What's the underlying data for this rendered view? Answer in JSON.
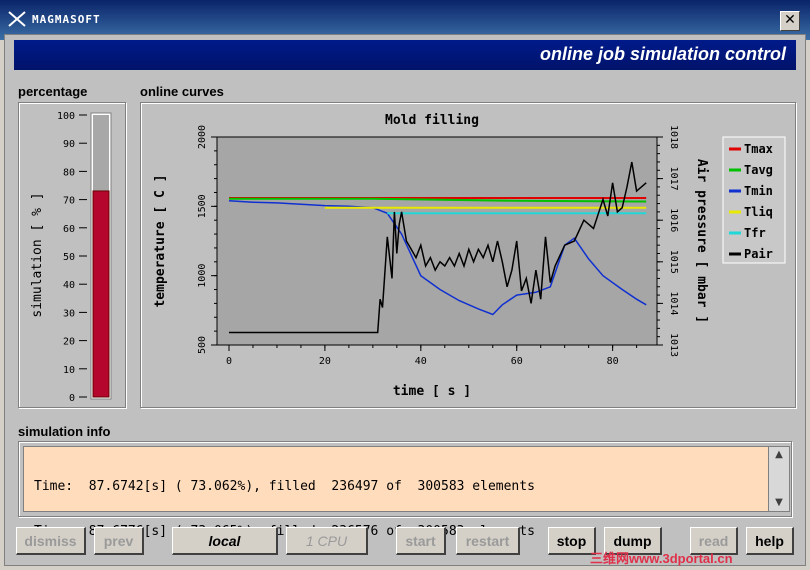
{
  "window": {
    "title": "MAGMASOFT",
    "close_label": "✕"
  },
  "header": {
    "banner_title": "online job simulation control"
  },
  "percentage": {
    "label": "percentage",
    "axis_label": "simulation [ % ]",
    "ticks": [
      "100",
      "90",
      "80",
      "70",
      "60",
      "50",
      "40",
      "30",
      "20",
      "10",
      "0"
    ],
    "value": 73.06,
    "fill_color": "#b5062d"
  },
  "curves": {
    "label": "online curves",
    "chart_data": {
      "type": "line",
      "title": "Mold filling",
      "xlabel": "time [ s ]",
      "ylabel": "temperature [ C ]",
      "y2label": "Air pressure [ mbar ]",
      "xlim": [
        0,
        88
      ],
      "ylim": [
        500,
        2000
      ],
      "y2lim": [
        1013,
        1018
      ],
      "x_ticks": [
        "0",
        "20",
        "40",
        "60",
        "80"
      ],
      "y_ticks": [
        "500",
        "1000",
        "1500",
        "2000"
      ],
      "y2_ticks": [
        "1013",
        "1014",
        "1015",
        "1016",
        "1017",
        "1018"
      ],
      "legend_position": "right",
      "series": [
        {
          "name": "Tmax",
          "color": "#e00000",
          "axis": "left",
          "x": [
            0,
            87
          ],
          "y": [
            1560,
            1560
          ]
        },
        {
          "name": "Tavg",
          "color": "#00c000",
          "axis": "left",
          "x": [
            0,
            30,
            60,
            87
          ],
          "y": [
            1555,
            1555,
            1540,
            1535
          ]
        },
        {
          "name": "Tmin",
          "color": "#1030d0",
          "axis": "left",
          "x": [
            0,
            5,
            10,
            15,
            20,
            25,
            30,
            33,
            36,
            38,
            40,
            44,
            48,
            52,
            55,
            57,
            60,
            64,
            67,
            70,
            72,
            75,
            78,
            82,
            85,
            87
          ],
          "y": [
            1540,
            1530,
            1525,
            1515,
            1505,
            1500,
            1490,
            1450,
            1300,
            1150,
            1000,
            900,
            820,
            760,
            720,
            790,
            860,
            880,
            920,
            1220,
            1270,
            1120,
            1000,
            900,
            830,
            790
          ]
        },
        {
          "name": "Tliq",
          "color": "#e8e800",
          "axis": "left",
          "x": [
            20,
            87
          ],
          "y": [
            1490,
            1490
          ]
        },
        {
          "name": "Tfr",
          "color": "#20d8d8",
          "axis": "left",
          "x": [
            33,
            87
          ],
          "y": [
            1450,
            1450
          ]
        },
        {
          "name": "Pair",
          "color": "#000000",
          "axis": "right",
          "x": [
            0,
            31,
            31.5,
            32,
            33,
            34,
            34.5,
            35,
            35.5,
            36,
            37,
            38,
            39,
            40,
            41,
            42,
            43,
            44,
            45,
            46,
            47,
            48,
            49,
            50,
            51,
            52,
            53,
            54,
            55,
            56,
            57,
            58,
            59,
            60,
            61,
            62,
            63,
            64,
            65,
            66,
            67,
            68,
            70,
            72,
            74,
            76,
            78,
            79,
            80,
            81,
            82,
            83,
            84,
            85,
            86,
            87
          ],
          "y": [
            1013.3,
            1013.3,
            1014.1,
            1013.9,
            1015.6,
            1014.6,
            1016.2,
            1015.2,
            1015.9,
            1016.2,
            1015.5,
            1015.3,
            1015.1,
            1015.4,
            1014.9,
            1015.1,
            1014.8,
            1015.0,
            1014.9,
            1015.1,
            1014.9,
            1015.2,
            1014.9,
            1015.3,
            1015.0,
            1015.3,
            1015.1,
            1015.4,
            1015.0,
            1015.5,
            1015.0,
            1014.4,
            1014.8,
            1015.5,
            1014.3,
            1014.6,
            1014.0,
            1014.8,
            1014.1,
            1015.6,
            1014.5,
            1014.9,
            1015.4,
            1015.5,
            1016.0,
            1015.8,
            1016.5,
            1016.1,
            1016.9,
            1016.2,
            1016.3,
            1016.8,
            1017.4,
            1016.7,
            1016.8,
            1016.9
          ]
        }
      ]
    }
  },
  "sim_info": {
    "label": "simulation info",
    "lines": [
      "Time:  87.6742[s] ( 73.062%), filled  236497 of  300583 elements",
      "Time:  87.6776[s] ( 73.065%), filled  236576 of  300583 elements"
    ],
    "bg_color": "#ffdcbc"
  },
  "buttons": {
    "dismiss": "dismiss",
    "prev": "prev",
    "local": "local",
    "cpu": "1 CPU",
    "start": "start",
    "restart": "restart",
    "stop": "stop",
    "dump": "dump",
    "read": "read",
    "help": "help"
  },
  "watermark": "三维网www.3dportal.cn"
}
